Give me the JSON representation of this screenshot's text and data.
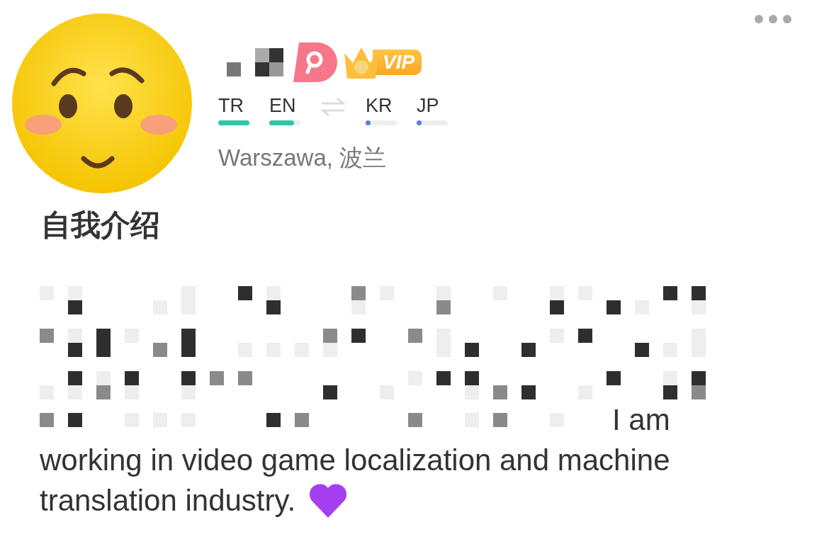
{
  "profile": {
    "badges": [
      {
        "kind": "partner"
      },
      {
        "kind": "vip",
        "label": "VIP"
      }
    ],
    "languages": [
      {
        "code": "TR",
        "kind": "native",
        "level": 1
      },
      {
        "code": "EN",
        "kind": "native",
        "level": 0.8
      },
      {
        "code": "KR",
        "kind": "learning",
        "level": 0.1
      },
      {
        "code": "JP",
        "kind": "learning",
        "level": 0.1
      }
    ],
    "location": "Warszawa, 波兰"
  },
  "intro": {
    "heading": "自我介绍",
    "visible_tail": "I am",
    "text_lines": [
      "working in video game localization and machine",
      "translation industry."
    ]
  }
}
